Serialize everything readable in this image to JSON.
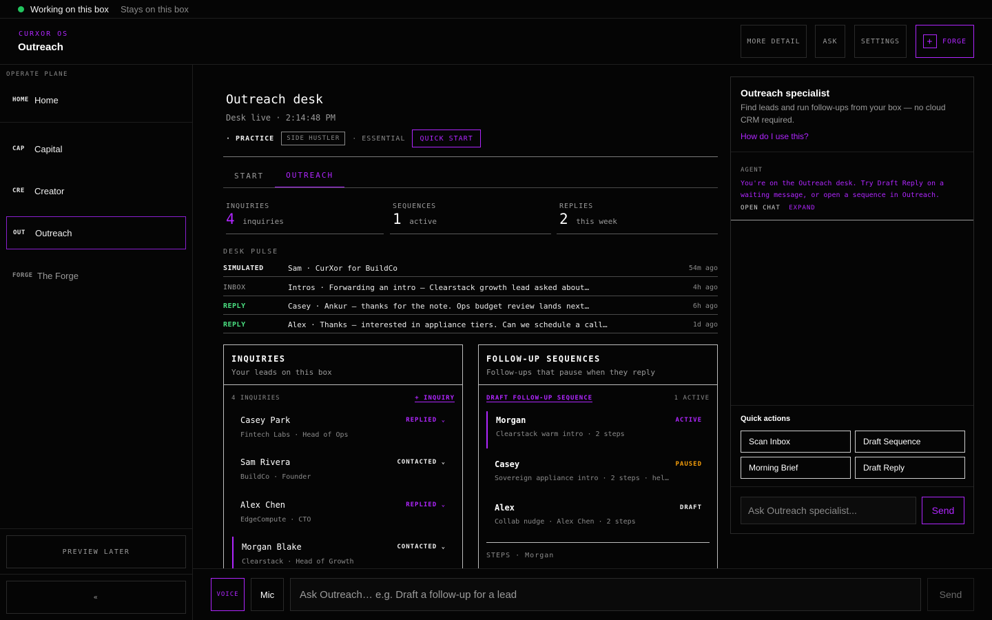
{
  "status": {
    "working": "Working on this box",
    "stays": "Stays on this box"
  },
  "header": {
    "brand_small": "CURXOR OS",
    "title": "Outreach",
    "buttons": {
      "more_detail": "MORE DETAIL",
      "ask": "ASK",
      "settings": "SETTINGS",
      "forge": "FORGE",
      "forge_icon": "+"
    }
  },
  "sidebar": {
    "plane_label": "OPERATE PLANE",
    "items": [
      {
        "code": "HOME",
        "label": "Home"
      },
      {
        "code": "CAP",
        "label": "Capital"
      },
      {
        "code": "CRE",
        "label": "Creator"
      },
      {
        "code": "OUT",
        "label": "Outreach"
      },
      {
        "code": "FORGE",
        "label": "The Forge"
      }
    ],
    "preview_later": "PREVIEW LATER",
    "collapse": "«"
  },
  "desk": {
    "title": "Outreach desk",
    "live": "Desk live · 2:14:48 PM",
    "tags": {
      "practice": "· PRACTICE",
      "side_hustler": "SIDE HUSTLER",
      "essential": "· ESSENTIAL",
      "quick_start": "QUICK START"
    },
    "tabs": [
      "START",
      "OUTREACH"
    ],
    "stats": [
      {
        "key": "INQUIRIES",
        "value": "4",
        "unit": "inquiries"
      },
      {
        "key": "SEQUENCES",
        "value": "1",
        "unit": "active"
      },
      {
        "key": "REPLIES",
        "value": "2",
        "unit": "this week"
      }
    ],
    "pulse_label": "DESK PULSE",
    "pulse": [
      {
        "type": "SIMULATED",
        "text": "Sam · CurXor for BuildCo",
        "when": "54m ago"
      },
      {
        "type": "INBOX",
        "text": "Intros · Forwarding an intro — Clearstack growth lead asked about…",
        "when": "4h ago"
      },
      {
        "type": "REPLY",
        "text": "Casey · Ankur — thanks for the note. Ops budget review lands next…",
        "when": "6h ago"
      },
      {
        "type": "REPLY",
        "text": "Alex · Thanks — interested in appliance tiers. Can we schedule a call…",
        "when": "1d ago"
      }
    ],
    "colors": {
      "accent": "#b026ff",
      "reply": "#4ade80",
      "paused": "#f59e0b"
    }
  },
  "inquiries": {
    "title": "INQUIRIES",
    "subtitle": "Your leads on this box",
    "count": "4 INQUIRIES",
    "add": "+ INQUIRY",
    "leads": [
      {
        "name": "Casey Park",
        "sub": "Fintech Labs · Head of Ops",
        "status": "REPLIED ⌄"
      },
      {
        "name": "Sam Rivera",
        "sub": "BuildCo · Founder",
        "status": "CONTACTED ⌄"
      },
      {
        "name": "Alex Chen",
        "sub": "EdgeCompute · CTO",
        "status": "REPLIED ⌄"
      },
      {
        "name": "Morgan Blake",
        "sub": "Clearstack · Head of Growth",
        "status": "CONTACTED ⌄"
      }
    ]
  },
  "sequences": {
    "title": "FOLLOW-UP SEQUENCES",
    "subtitle": "Follow-ups that pause when they reply",
    "draft": "DRAFT FOLLOW-UP SEQUENCE",
    "active_count": "1 ACTIVE",
    "items": [
      {
        "name": "Morgan",
        "sub": "Clearstack warm intro · 2 steps",
        "status": "ACTIVE"
      },
      {
        "name": "Casey",
        "sub": "Sovereign appliance intro · 2 steps · hel…",
        "status": "PAUSED"
      },
      {
        "name": "Alex",
        "sub": "Collab nudge · Alex Chen · 2 steps",
        "status": "DRAFT"
      }
    ],
    "steps_label": "STEPS · Morgan"
  },
  "specialist": {
    "title": "Outreach specialist",
    "subtitle": "Find leads and run follow-ups from your box — no cloud CRM required.",
    "help": "How do I use this?",
    "agent_label": "AGENT",
    "agent_msg": "You're on the Outreach desk. Try Draft Reply on a waiting message, or open a sequence in Outreach.",
    "open_chat": "OPEN CHAT",
    "expand": "EXPAND",
    "quick_actions_label": "Quick actions",
    "quick_actions": [
      "Scan Inbox",
      "Draft Sequence",
      "Morning Brief",
      "Draft Reply"
    ],
    "input_placeholder": "Ask Outreach specialist...",
    "send": "Send"
  },
  "bottom": {
    "voice": "VOICE",
    "mic": "Mic",
    "input_placeholder": "Ask Outreach… e.g. Draft a follow-up for a lead",
    "send": "Send"
  }
}
